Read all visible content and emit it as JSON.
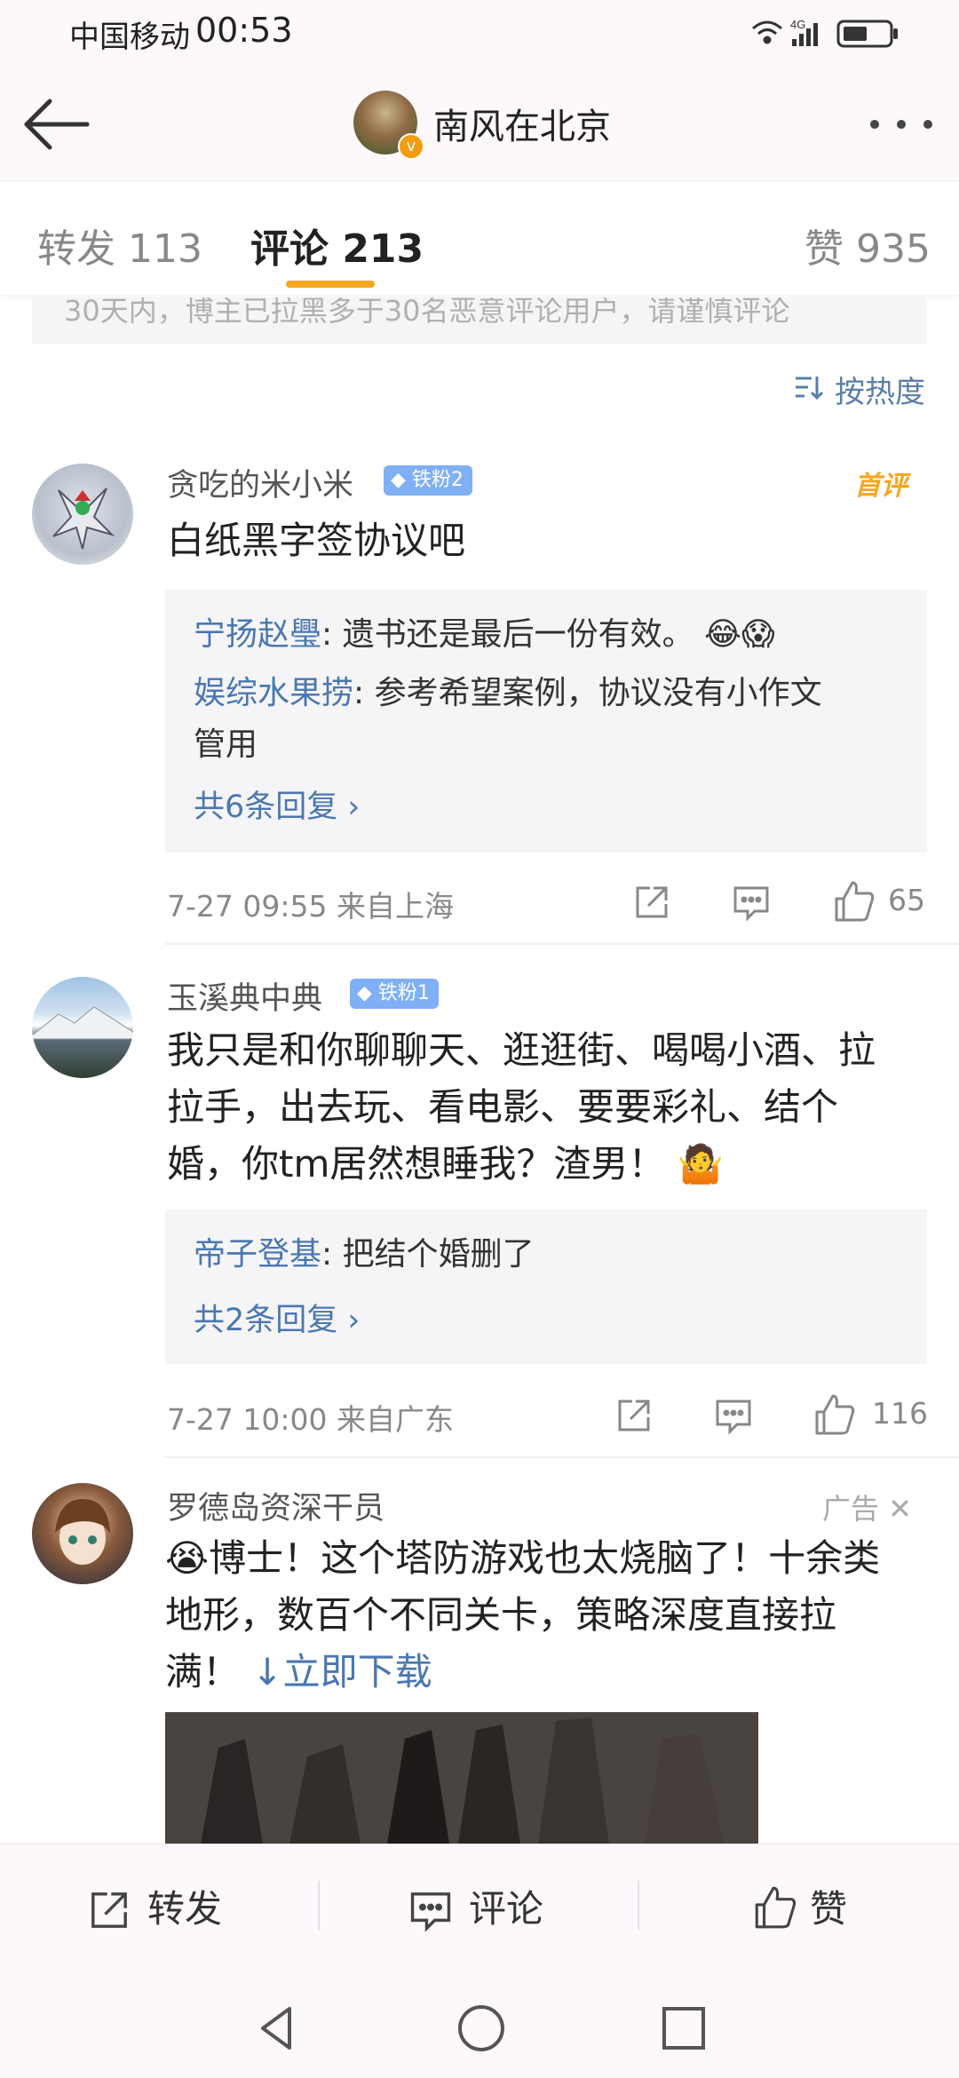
{
  "status_bar": {
    "carrier": "中国移动",
    "time": "00:53",
    "network": "4G"
  },
  "header": {
    "title": "南风在北京",
    "back_icon": "arrow-left-icon",
    "more_icon": "more-dots-icon"
  },
  "tabs": [
    {
      "label": "转发 113",
      "active": false
    },
    {
      "label": "评论 213",
      "active": true
    },
    {
      "label": "赞 935",
      "active": false
    }
  ],
  "notice": "30天内，博主已拉黑多于30名恶意评论用户，请谨慎评论",
  "sort_label": "按热度",
  "comments": [
    {
      "username": "贪吃的米小米",
      "badge": "铁粉2",
      "first_label": "首评",
      "text": "白纸黑字签协议吧",
      "replies": [
        {
          "name": "宁扬赵璺",
          "text": ": 遗书还是最后一份有效。"
        },
        {
          "name": "娱综水果捞",
          "text": ": 参考希望案例，协议没有小作文"
        },
        {
          "name": "",
          "text": "管用"
        }
      ],
      "more_replies": "共6条回复 ›",
      "meta": "7-27 09:55  来自上海",
      "likes": "65"
    },
    {
      "username": "玉溪典中典",
      "badge": "铁粉1",
      "text_lines": [
        "我只是和你聊聊天、逛逛街、喝喝小酒、拉",
        "拉手，出去玩、看电影、要要彩礼、结个",
        "婚，你tm居然想睡我？渣男！"
      ],
      "replies": [
        {
          "name": "帝子登基",
          "text": ": 把结个婚删了"
        }
      ],
      "more_replies": "共2条回复 ›",
      "meta": "7-27 10:00  来自广东",
      "likes": "116"
    },
    {
      "username": "罗德岛资深干员",
      "ad_label": "广告 ✕",
      "text_lines": [
        "博士！这个塔防游戏也太烧脑了！十余类",
        "地形，数百个不同关卡，策略深度直接拉",
        "满！"
      ],
      "download": "立即下载"
    }
  ],
  "bottom_bar": {
    "repost": "转发",
    "comment": "评论",
    "like": "赞"
  },
  "colors": {
    "accent": "#f5a623",
    "link": "#4a77b0",
    "badge": "#7fb0f5"
  }
}
